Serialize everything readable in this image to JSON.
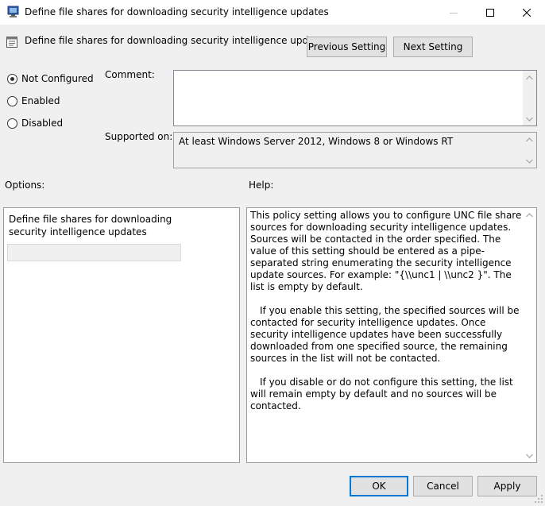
{
  "window": {
    "title": "Define file shares for downloading security intelligence updates",
    "minimize_icon": "minimize-icon",
    "maximize_icon": "maximize-icon",
    "close_icon": "close-icon"
  },
  "header": {
    "setting_name": "Define file shares for downloading security intelligence updates",
    "previous_label": "Previous Setting",
    "next_label": "Next Setting"
  },
  "state": {
    "options": [
      {
        "label": "Not Configured",
        "checked": true
      },
      {
        "label": "Enabled",
        "checked": false
      },
      {
        "label": "Disabled",
        "checked": false
      }
    ]
  },
  "comment": {
    "label": "Comment:",
    "value": ""
  },
  "supported": {
    "label": "Supported on:",
    "value": "At least Windows Server 2012, Windows 8 or Windows RT"
  },
  "options_panel": {
    "label": "Options:",
    "field_label": "Define file shares for downloading security intelligence updates",
    "field_value": ""
  },
  "help_panel": {
    "label": "Help:",
    "paragraphs": [
      "This policy setting allows you to configure UNC file share sources for downloading security intelligence updates. Sources will be contacted in the order specified. The value of this setting should be entered as a pipe-separated string enumerating the security intelligence update sources. For example: \"{\\\\unc1 | \\\\unc2 }\". The list is empty by default.",
      "If you enable this setting, the specified sources will be contacted for security intelligence updates. Once security intelligence updates have been successfully downloaded from one specified source, the remaining sources in the list will not be contacted.",
      "If you disable or do not configure this setting, the list will remain empty by default and no sources will be contacted."
    ]
  },
  "footer": {
    "ok_label": "OK",
    "cancel_label": "Cancel",
    "apply_label": "Apply"
  },
  "colors": {
    "accent": "#0078d7",
    "window_bg": "#f0f0f0"
  }
}
